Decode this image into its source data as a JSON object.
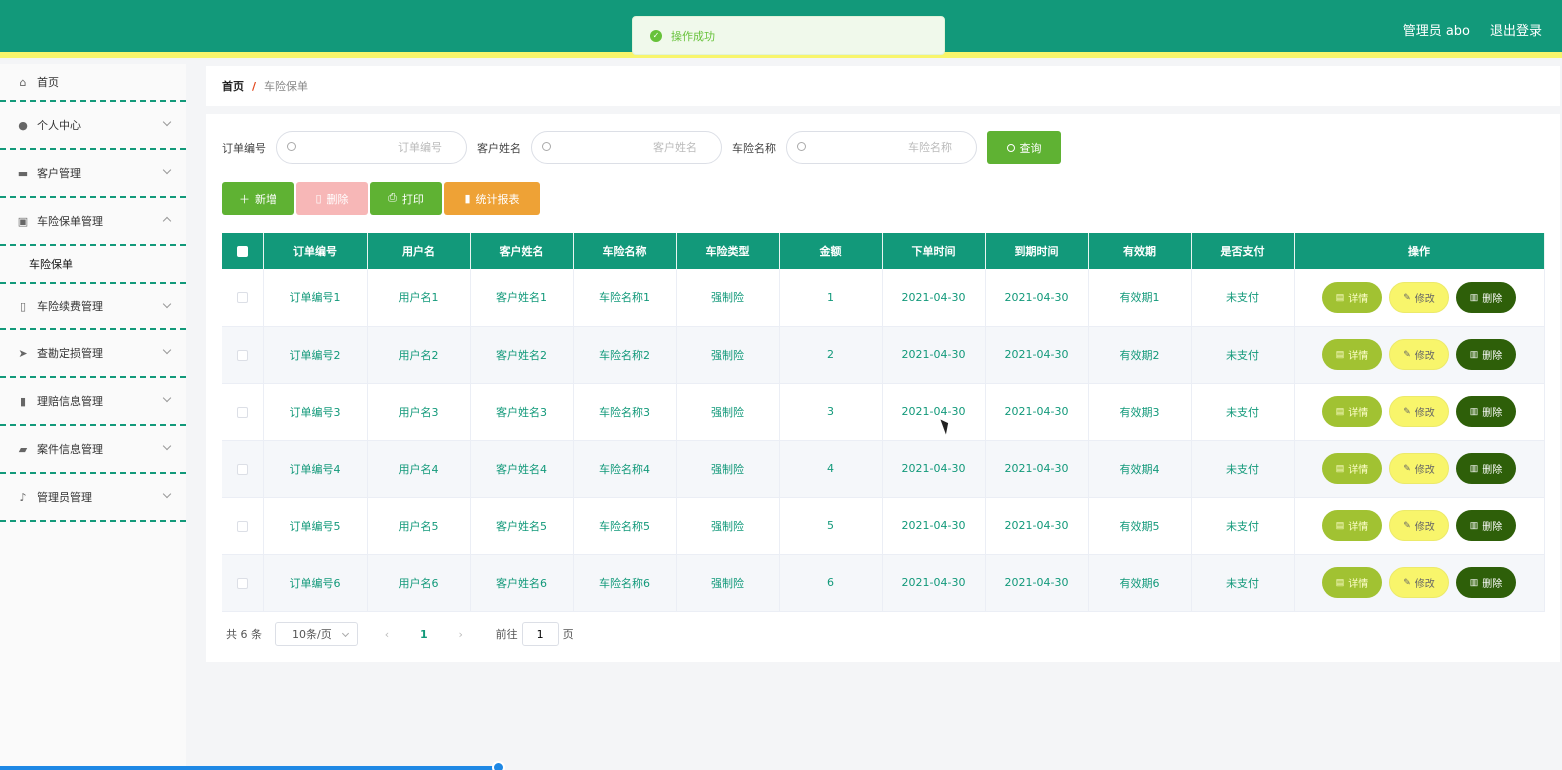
{
  "header": {
    "user_label": "管理员 abo",
    "logout_label": "退出登录",
    "accent": "#12997a",
    "stripe": "#f8f56b"
  },
  "toast": {
    "message": "操作成功",
    "icon": "check-circle-icon"
  },
  "sidebar": {
    "items": [
      {
        "label": "首页",
        "icon": "home-icon"
      },
      {
        "label": "个人中心",
        "icon": "user-icon"
      },
      {
        "label": "客户管理",
        "icon": "folder-icon"
      },
      {
        "label": "车险保单管理",
        "icon": "clipboard-icon",
        "expanded": true,
        "children": [
          {
            "label": "车险保单"
          }
        ]
      },
      {
        "label": "车险续费管理",
        "icon": "mobile-icon"
      },
      {
        "label": "查勘定损管理",
        "icon": "send-icon"
      },
      {
        "label": "理赔信息管理",
        "icon": "bar-chart-icon"
      },
      {
        "label": "案件信息管理",
        "icon": "briefcase-icon"
      },
      {
        "label": "管理员管理",
        "icon": "microphone-icon"
      }
    ]
  },
  "breadcrumb": {
    "home": "首页",
    "separator": "/",
    "current": "车险保单"
  },
  "search": {
    "fields": [
      {
        "label": "订单编号",
        "placeholder": "订单编号",
        "value": ""
      },
      {
        "label": "客户姓名",
        "placeholder": "客户姓名",
        "value": ""
      },
      {
        "label": "车险名称",
        "placeholder": "车险名称",
        "value": ""
      }
    ],
    "button_label": "查询"
  },
  "actions": {
    "add": "新增",
    "delete": "删除",
    "print": "打印",
    "report": "统计报表"
  },
  "table": {
    "columns": [
      "订单编号",
      "用户名",
      "客户姓名",
      "车险名称",
      "车险类型",
      "金额",
      "下单时间",
      "到期时间",
      "有效期",
      "是否支付",
      "操作"
    ],
    "rows": [
      [
        "订单编号1",
        "用户名1",
        "客户姓名1",
        "车险名称1",
        "强制险",
        "1",
        "2021-04-30",
        "2021-04-30",
        "有效期1",
        "未支付"
      ],
      [
        "订单编号2",
        "用户名2",
        "客户姓名2",
        "车险名称2",
        "强制险",
        "2",
        "2021-04-30",
        "2021-04-30",
        "有效期2",
        "未支付"
      ],
      [
        "订单编号3",
        "用户名3",
        "客户姓名3",
        "车险名称3",
        "强制险",
        "3",
        "2021-04-30",
        "2021-04-30",
        "有效期3",
        "未支付"
      ],
      [
        "订单编号4",
        "用户名4",
        "客户姓名4",
        "车险名称4",
        "强制险",
        "4",
        "2021-04-30",
        "2021-04-30",
        "有效期4",
        "未支付"
      ],
      [
        "订单编号5",
        "用户名5",
        "客户姓名5",
        "车险名称5",
        "强制险",
        "5",
        "2021-04-30",
        "2021-04-30",
        "有效期5",
        "未支付"
      ],
      [
        "订单编号6",
        "用户名6",
        "客户姓名6",
        "车险名称6",
        "强制险",
        "6",
        "2021-04-30",
        "2021-04-30",
        "有效期6",
        "未支付"
      ]
    ],
    "row_actions": {
      "detail": "详情",
      "edit": "修改",
      "delete": "删除"
    }
  },
  "pagination": {
    "total": "共 6 条",
    "page_size": "10条/页",
    "current_page": "1",
    "goto_prefix": "前往",
    "goto_value": "1",
    "goto_suffix": "页"
  }
}
